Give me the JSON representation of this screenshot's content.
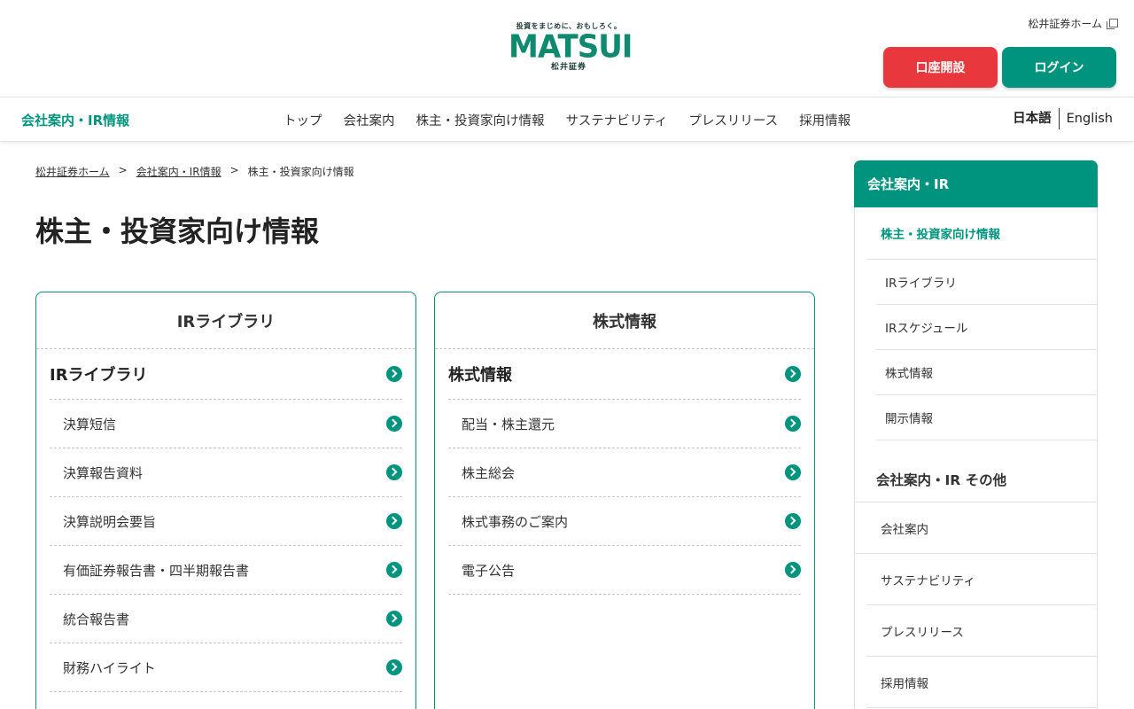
{
  "header": {
    "logo_tagline": "投資をまじめに、おもしろく。",
    "logo_main": "MATSUI",
    "logo_sub": "松井証券",
    "home_link": "松井証券ホーム",
    "open_account_label": "口座開設",
    "login_label": "ログイン"
  },
  "nav": {
    "brand": "会社案内・IR情報",
    "links": [
      "トップ",
      "会社案内",
      "株主・投資家向け情報",
      "サステナビリティ",
      "プレスリリース",
      "採用情報"
    ],
    "lang_ja": "日本語",
    "lang_en": "English"
  },
  "breadcrumb": {
    "items": [
      "松井証券ホーム",
      "会社案内・IR情報",
      "株主・投資家向け情報"
    ],
    "separator": ">"
  },
  "page_title": "株主・投資家向け情報",
  "cards": [
    {
      "title": "IRライブラリ",
      "main": "IRライブラリ",
      "items": [
        "決算短信",
        "決算報告資料",
        "決算説明会要旨",
        "有価証券報告書・四半期報告書",
        "統合報告書",
        "財務ハイライト"
      ]
    },
    {
      "title": "株式情報",
      "main": "株式情報",
      "items": [
        "配当・株主還元",
        "株主総会",
        "株式事務のご案内",
        "電子公告"
      ]
    }
  ],
  "sidebar": {
    "title": "会社案内・IR",
    "items": [
      "株主・投資家向け情報",
      "IRライブラリ",
      "IRスケジュール",
      "株式情報",
      "開示情報"
    ],
    "other_title": "会社案内・IR その他",
    "other_items": [
      "会社案内",
      "サステナビリティ",
      "プレスリリース",
      "採用情報"
    ]
  },
  "colors": {
    "brand_green": "#00947e",
    "open_account_red": "#e8383d"
  }
}
